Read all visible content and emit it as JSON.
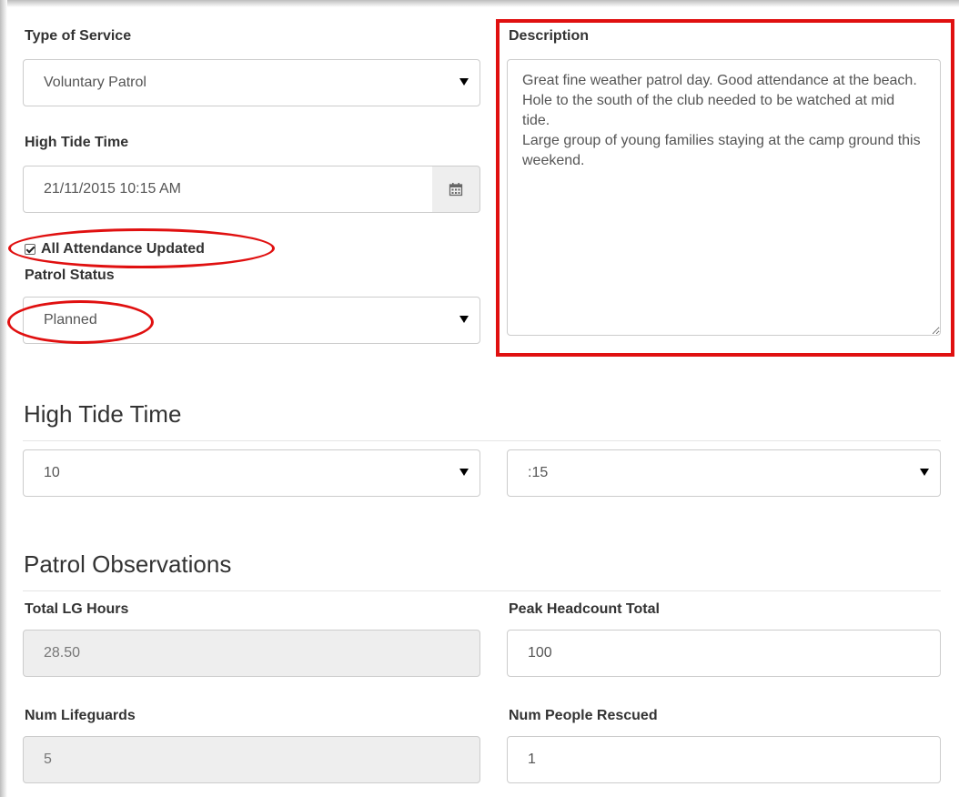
{
  "form": {
    "type_of_service": {
      "label": "Type of Service",
      "value": "Voluntary Patrol"
    },
    "high_tide_time": {
      "label": "High Tide Time",
      "value": "21/11/2015 10:15 AM"
    },
    "all_attendance": {
      "label": "All Attendance Updated",
      "checked": true
    },
    "patrol_status": {
      "label": "Patrol Status",
      "value": "Planned"
    },
    "description": {
      "label": "Description",
      "value": "Great fine weather patrol day. Good attendance at the beach.\nHole to the south of the club needed to be watched at mid tide.\nLarge group of young families staying at the camp ground this weekend."
    }
  },
  "high_tide_section": {
    "heading": "High Tide Time",
    "hour": "10",
    "minute": ":15"
  },
  "observations": {
    "heading": "Patrol Observations",
    "total_lg_hours": {
      "label": "Total LG Hours",
      "value": "28.50"
    },
    "peak_headcount": {
      "label": "Peak Headcount Total",
      "value": "100"
    },
    "num_lifeguards": {
      "label": "Num Lifeguards",
      "value": "5"
    },
    "num_rescued": {
      "label": "Num People Rescued",
      "value": "1"
    }
  },
  "annotation_color": "#e01010"
}
